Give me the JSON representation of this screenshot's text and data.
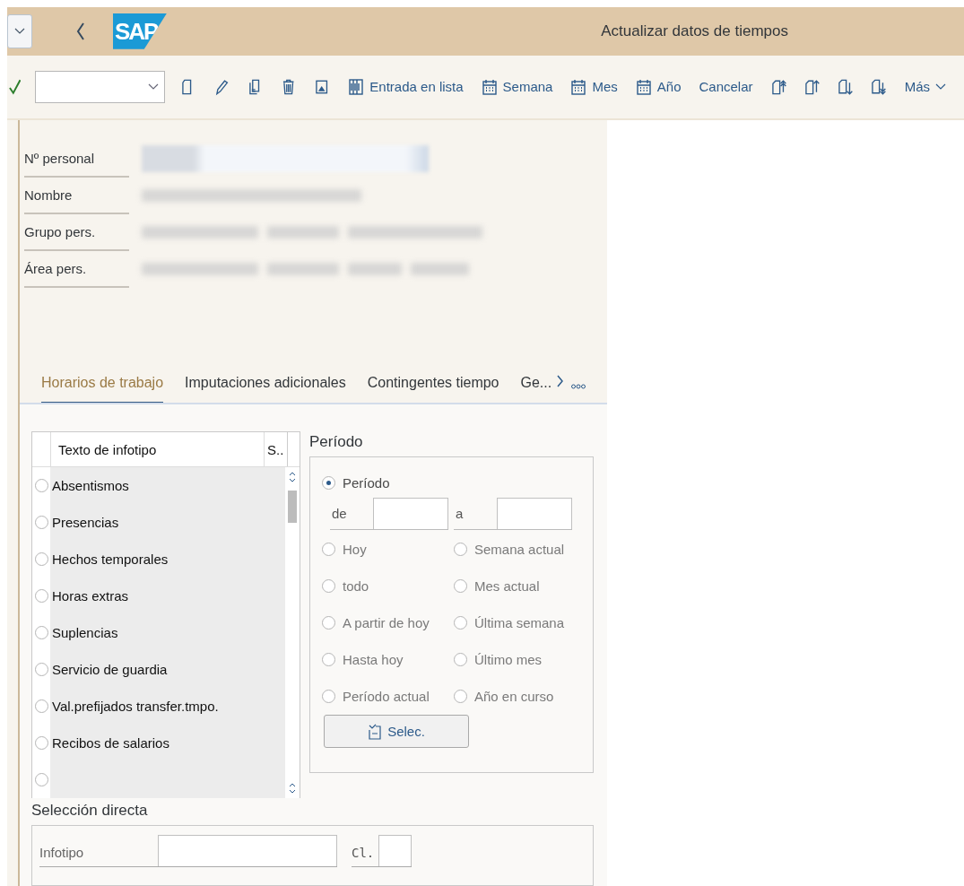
{
  "header": {
    "logo": "SAP",
    "title": "Actualizar datos de tiempos"
  },
  "toolbar": {
    "buttons": [
      "Entrada en lista",
      "Semana",
      "Mes",
      "Año",
      "Cancelar"
    ],
    "more": "Más"
  },
  "header_fields": [
    {
      "label": "Nº personal"
    },
    {
      "label": "Nombre"
    },
    {
      "label": "Grupo pers."
    },
    {
      "label": "Área pers."
    }
  ],
  "tabs": [
    {
      "label": "Horarios de trabajo",
      "selected": true
    },
    {
      "label": "Imputaciones adicionales",
      "selected": false
    },
    {
      "label": "Contingentes tiempo",
      "selected": false
    },
    {
      "label": "Ge...",
      "selected": false
    }
  ],
  "infotype_table": {
    "columns": [
      "Texto de infotipo",
      "S.."
    ],
    "rows": [
      {
        "label": "Absentismos",
        "selected": false
      },
      {
        "label": "Presencias",
        "selected": false
      },
      {
        "label": "Hechos temporales",
        "selected": false
      },
      {
        "label": "Horas extras",
        "selected": false
      },
      {
        "label": "Suplencias",
        "selected": false
      },
      {
        "label": "Servicio de guardia",
        "selected": false
      },
      {
        "label": "Val.prefijados transfer.tmpo.",
        "selected": false
      },
      {
        "label": "Recibos de salarios",
        "selected": false
      },
      {
        "selected": false
      }
    ]
  },
  "period": {
    "title": "Período",
    "range": {
      "label": "Período",
      "selected": true,
      "from_label": "de",
      "to_label": "a"
    },
    "options": [
      {
        "label": "Hoy",
        "selected": false
      },
      {
        "label": "Semana actual",
        "selected": false
      },
      {
        "label": "todo",
        "selected": false
      },
      {
        "label": "Mes actual",
        "selected": false
      },
      {
        "label": "A partir de hoy",
        "selected": false
      },
      {
        "label": "Última semana",
        "selected": false
      },
      {
        "label": "Hasta hoy",
        "selected": false
      },
      {
        "label": "Último mes",
        "selected": false
      },
      {
        "label": "Período actual",
        "selected": false
      },
      {
        "label": "Año en curso",
        "selected": false
      }
    ],
    "button": "Selec."
  },
  "direct_selection": {
    "title": "Selección directa",
    "infotype_label": "Infotipo",
    "class_label": "Cl."
  }
}
